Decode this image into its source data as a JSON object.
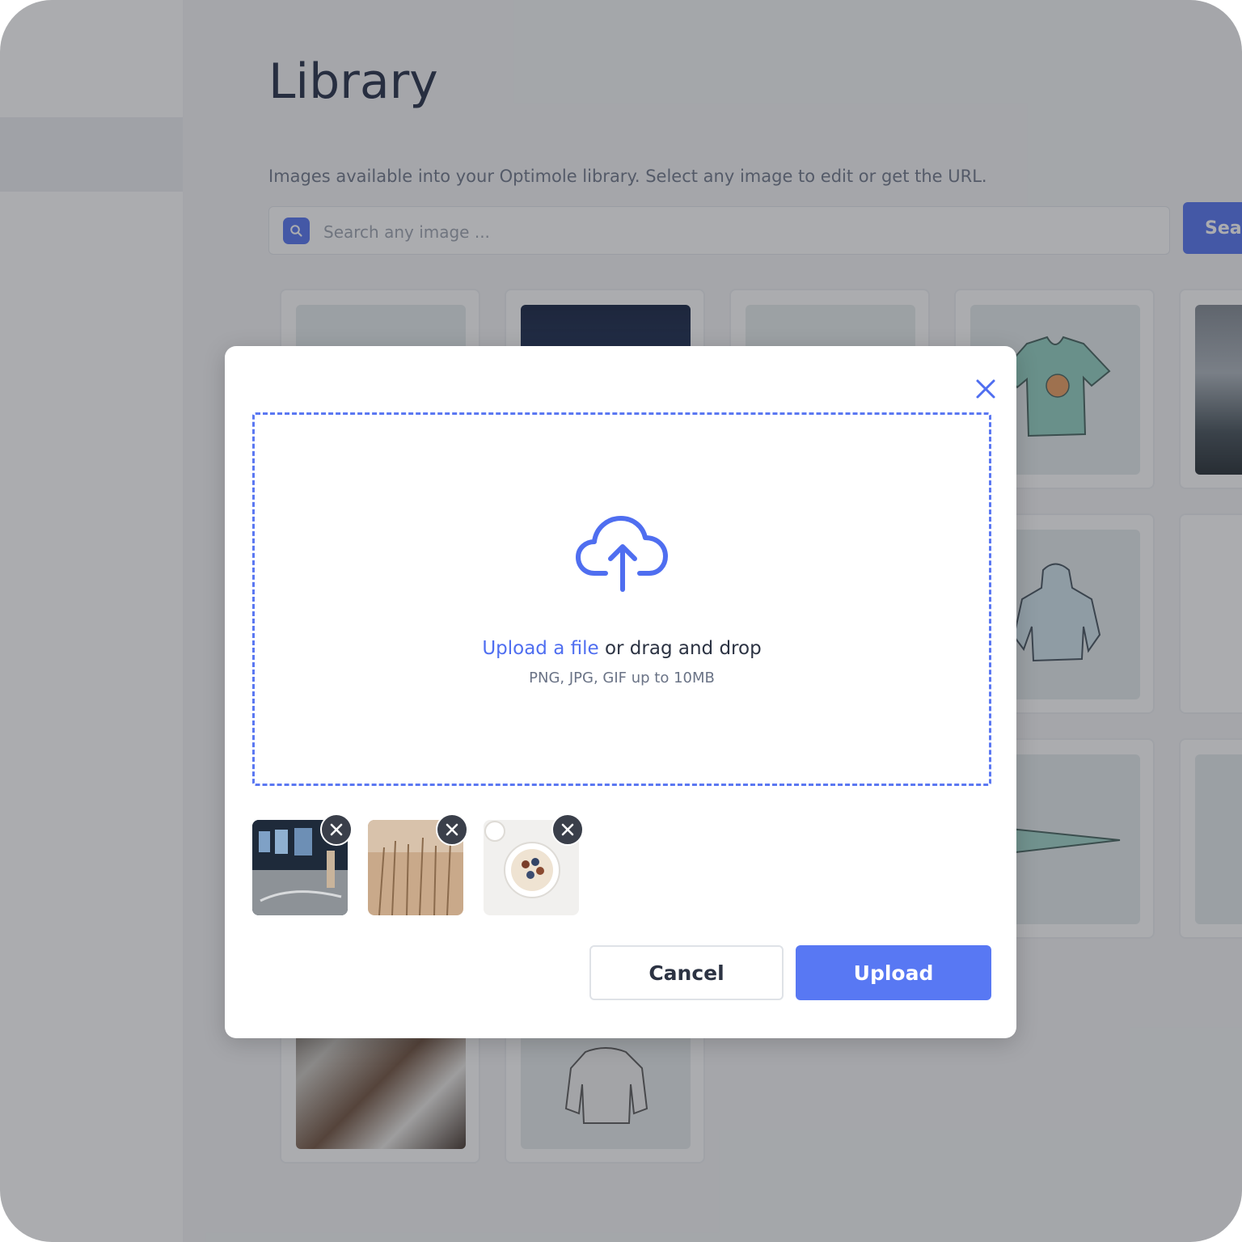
{
  "library": {
    "title": "Library",
    "subtitle": "Images available into your Optimole library. Select any image to edit or get the URL.",
    "search_placeholder": "Search any image ...",
    "search_button": "Sear"
  },
  "modal": {
    "upload_link": "Upload a file",
    "drop_text": " or drag and drop",
    "hint": "PNG, JPG, GIF up to 10MB",
    "cancel_label": "Cancel",
    "upload_label": "Upload"
  },
  "colors": {
    "accent": "#4f6ef0",
    "dropzone_border": "#5b78f2",
    "remove_badge": "#3a3f4a"
  },
  "icons": {
    "search": "search-icon",
    "close": "close-icon",
    "upload": "cloud-upload-icon",
    "remove": "remove-icon"
  }
}
